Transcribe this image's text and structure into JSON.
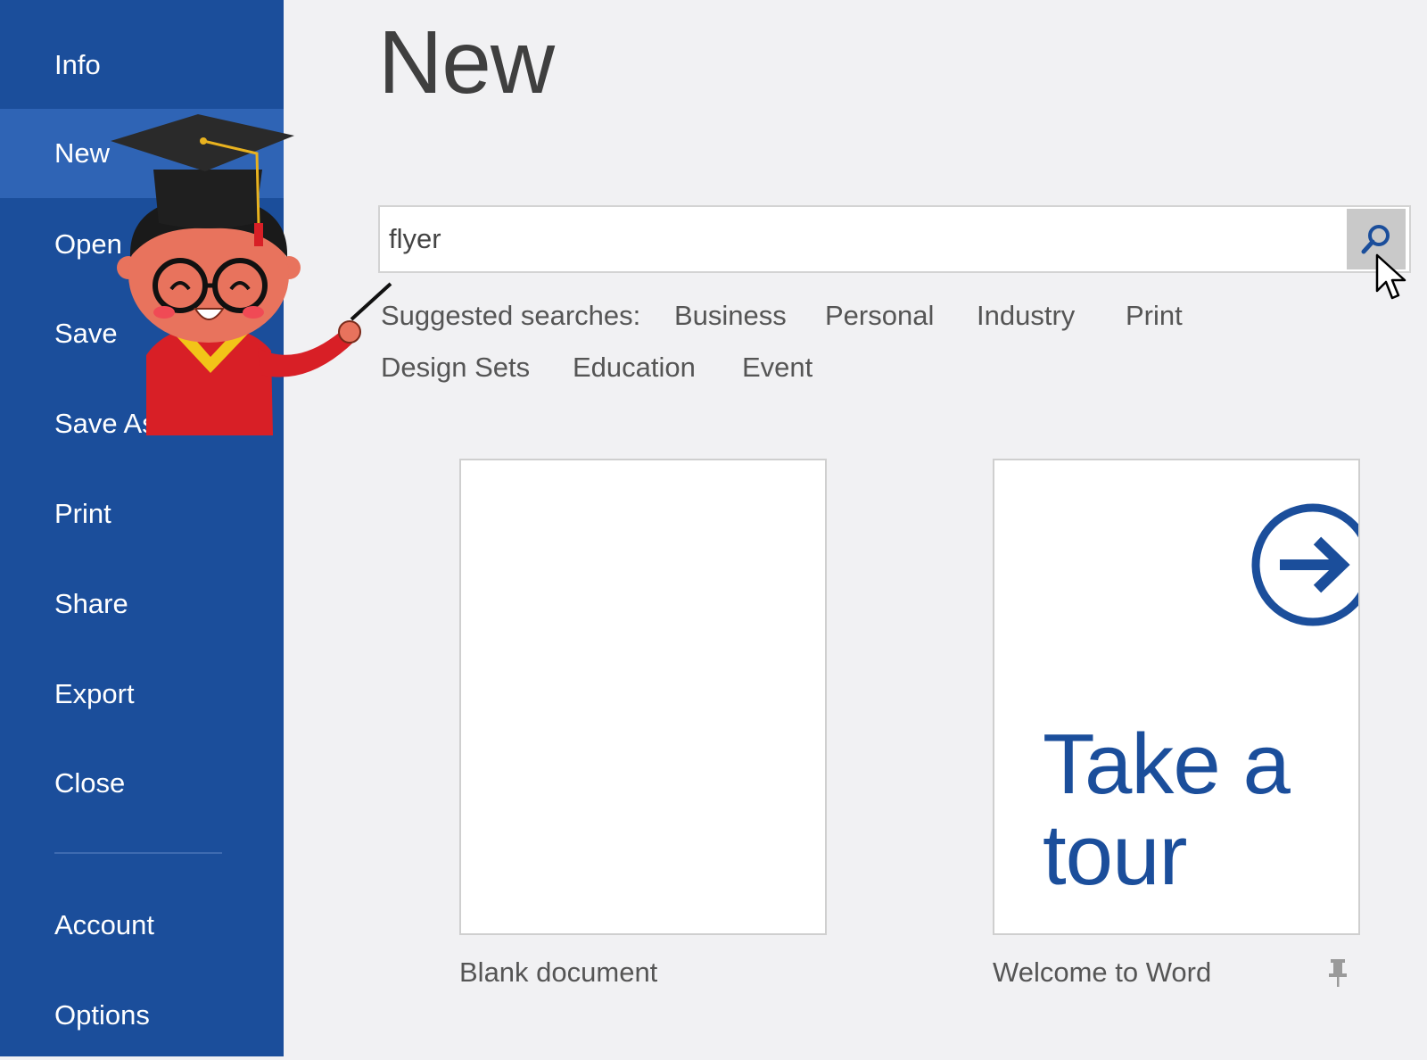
{
  "sidebar": {
    "items": [
      {
        "label": "Info"
      },
      {
        "label": "New"
      },
      {
        "label": "Open"
      },
      {
        "label": "Save"
      },
      {
        "label": "Save As"
      },
      {
        "label": "Print"
      },
      {
        "label": "Share"
      },
      {
        "label": "Export"
      },
      {
        "label": "Close"
      },
      {
        "label": "Account"
      },
      {
        "label": "Options"
      }
    ],
    "active_item": "New"
  },
  "main": {
    "title": "New",
    "search": {
      "value": "flyer",
      "icon": "search-icon"
    },
    "suggested": {
      "label": "Suggested searches:",
      "items": [
        "Business",
        "Personal",
        "Industry",
        "Print",
        "Design Sets",
        "Education",
        "Event"
      ]
    },
    "templates": [
      {
        "caption": "Blank document"
      },
      {
        "caption": "Welcome to Word",
        "thumbnail_line1": "Take a",
        "thumbnail_line2": "tour",
        "pinned_icon": "pin-icon"
      }
    ]
  },
  "colors": {
    "sidebar_bg": "#1b4e9b",
    "sidebar_active": "#2f64b5",
    "page_bg": "#f1f1f3",
    "accent": "#1b4e9b"
  }
}
